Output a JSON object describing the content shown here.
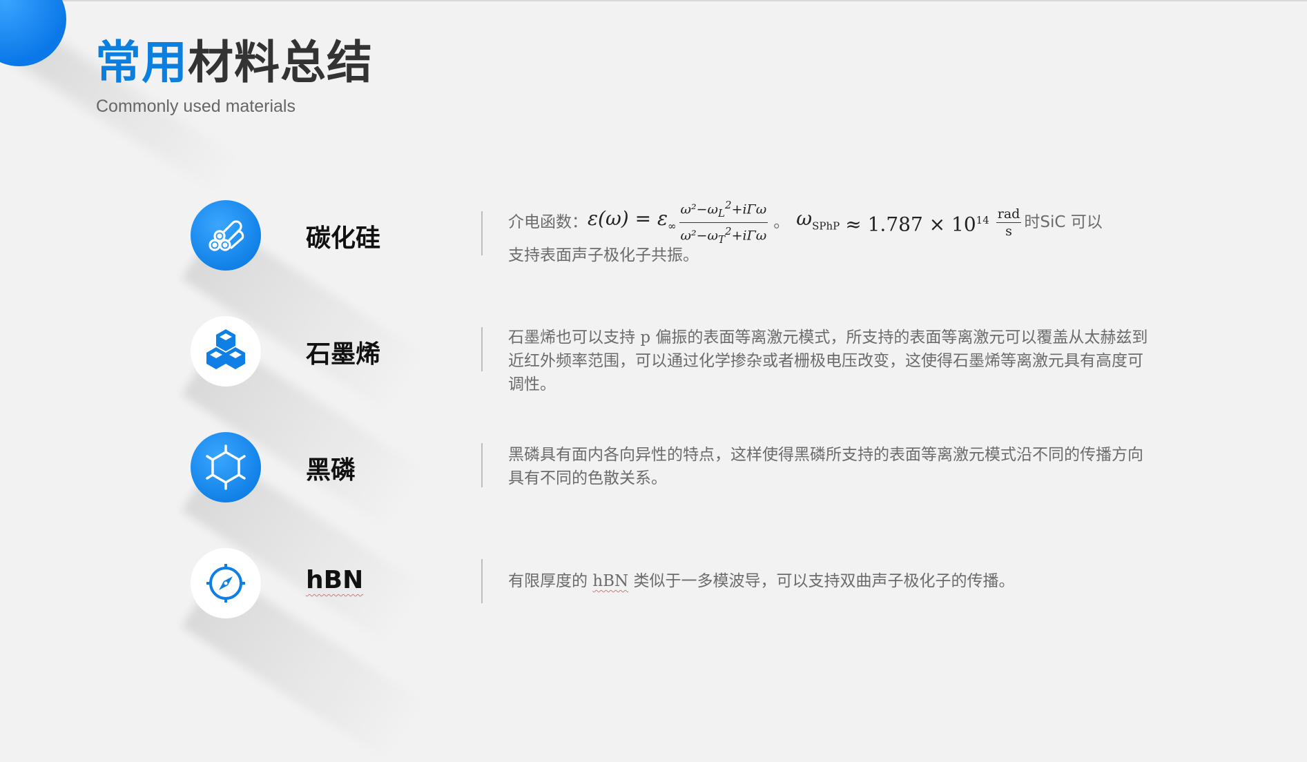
{
  "header": {
    "title_blue": "常用",
    "title_dark": "材料总结",
    "subtitle": "Commonly used materials"
  },
  "materials": [
    {
      "name": "碳化硅",
      "icon": "logs-icon",
      "icon_style": "blue",
      "desc_prefix": "介电函数：",
      "desc_mid": "。",
      "desc_suffix": "时SiC 可以",
      "desc_line2": "支持表面声子极化子共振。",
      "formula": {
        "lhs": "ε(ω) = ε",
        "lhs_sub": "∞",
        "num": "ω²−ω",
        "num_sub": "L",
        "num_sup": "2",
        "num_tail": "+iΓω",
        "den": "ω²−ω",
        "den_sub": "T",
        "den_sup": "2",
        "den_tail": "+iΓω",
        "omega": "ω",
        "omega_sub": "SPhP",
        "value": "≈ 1.787 × 10",
        "exp": "14",
        "unit_num": "rad",
        "unit_den": "s"
      }
    },
    {
      "name": "石墨烯",
      "icon": "hexagon-cubes-icon",
      "icon_style": "white",
      "desc_a": "石墨烯也可以支持 ",
      "desc_p": "p",
      "desc_b": " 偏振的表面等离激元模式，所支持的表面等离激元可以覆盖从太赫兹到近红外频率范围，可以通过化学掺杂或者栅极电压改变，这使得石墨烯等离激元具有高度可调性。"
    },
    {
      "name": "黑磷",
      "icon": "hexagon-molecule-icon",
      "icon_style": "blue",
      "desc": "黑磷具有面内各向异性的特点，这样使得黑磷所支持的表面等离激元模式沿不同的传播方向具有不同的色散关系。"
    },
    {
      "name": "hBN",
      "icon": "compass-icon",
      "icon_style": "white",
      "desc_a": "有限厚度的 ",
      "desc_b": "hBN",
      "desc_c": " 类似于一多模波导，可以支持双曲声子极化子的传播。"
    }
  ],
  "colors": {
    "accent_blue": "#0b7fe0",
    "title_dark": "#333333",
    "text_gray": "#6b6b6b",
    "background": "#f2f2f2"
  }
}
